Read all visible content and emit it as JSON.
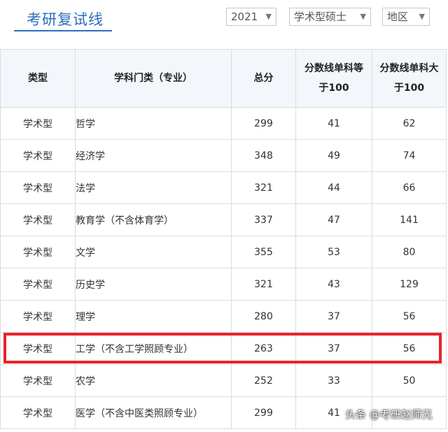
{
  "header": {
    "title": "考研复试线",
    "filters": {
      "year": "2021",
      "degree_type": "学术型硕士",
      "region": "地区"
    }
  },
  "table": {
    "columns": [
      "类型",
      "学科门类（专业）",
      "总分",
      "分数线单科等于100",
      "分数线单科大于100"
    ],
    "rows": [
      [
        "学术型",
        "哲学",
        "299",
        "41",
        "62"
      ],
      [
        "学术型",
        "经济学",
        "348",
        "49",
        "74"
      ],
      [
        "学术型",
        "法学",
        "321",
        "44",
        "66"
      ],
      [
        "学术型",
        "教育学（不含体育学）",
        "337",
        "47",
        "141"
      ],
      [
        "学术型",
        "文学",
        "355",
        "53",
        "80"
      ],
      [
        "学术型",
        "历史学",
        "321",
        "43",
        "129"
      ],
      [
        "学术型",
        "理学",
        "280",
        "37",
        "56"
      ],
      [
        "学术型",
        "工学（不含工学照顾专业）",
        "263",
        "37",
        "56"
      ],
      [
        "学术型",
        "农学",
        "252",
        "33",
        "50"
      ],
      [
        "学术型",
        "医学（不含中医类照顾专业）",
        "299",
        "41",
        ""
      ]
    ]
  },
  "watermark": "头条 @考研赵师兄",
  "colors": {
    "accent": "#2b6ebf",
    "highlight": "#e8232a",
    "header_bg": "#f3f6fa"
  }
}
